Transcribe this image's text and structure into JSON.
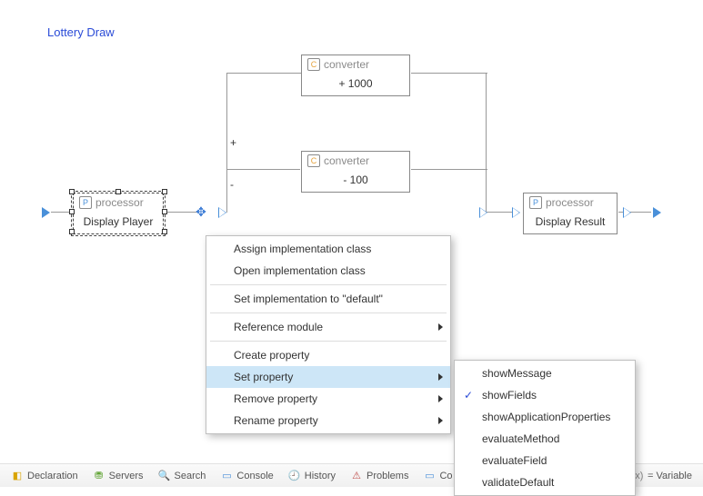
{
  "diagram": {
    "title": "Lottery Draw",
    "nodes": {
      "display_player": {
        "type_label": "processor",
        "body": "Display Player",
        "icon_letter": "P"
      },
      "conv_plus": {
        "type_label": "converter",
        "body": "+ 1000",
        "icon_letter": "C"
      },
      "conv_minus": {
        "type_label": "converter",
        "body": "- 100",
        "icon_letter": "C"
      },
      "display_result": {
        "type_label": "processor",
        "body": "Display Result",
        "icon_letter": "P"
      }
    },
    "branch": {
      "plus_label": "+",
      "minus_label": "-"
    }
  },
  "context_menu": {
    "items": [
      {
        "label": "Assign implementation class",
        "has_sub": false
      },
      {
        "label": "Open implementation class",
        "has_sub": false
      },
      {
        "sep": true
      },
      {
        "label": "Set implementation to \"default\"",
        "has_sub": false
      },
      {
        "sep": true
      },
      {
        "label": "Reference module",
        "has_sub": true
      },
      {
        "sep": true
      },
      {
        "label": "Create property",
        "has_sub": false
      },
      {
        "label": "Set property",
        "has_sub": true,
        "hover": true
      },
      {
        "label": "Remove property",
        "has_sub": true
      },
      {
        "label": "Rename property",
        "has_sub": true
      }
    ],
    "set_property_sub": [
      {
        "label": "showMessage",
        "checked": false
      },
      {
        "label": "showFields",
        "checked": true
      },
      {
        "label": "showApplicationProperties",
        "checked": false
      },
      {
        "label": "evaluateMethod",
        "checked": false
      },
      {
        "label": "evaluateField",
        "checked": false
      },
      {
        "label": "validateDefault",
        "checked": false
      }
    ]
  },
  "bottom_tabs": {
    "declaration": "Declaration",
    "servers": "Servers",
    "search": "Search",
    "console": "Console",
    "history": "History",
    "problems": "Problems",
    "co_prefix": "Co",
    "variable_suffix": "= Variable"
  }
}
